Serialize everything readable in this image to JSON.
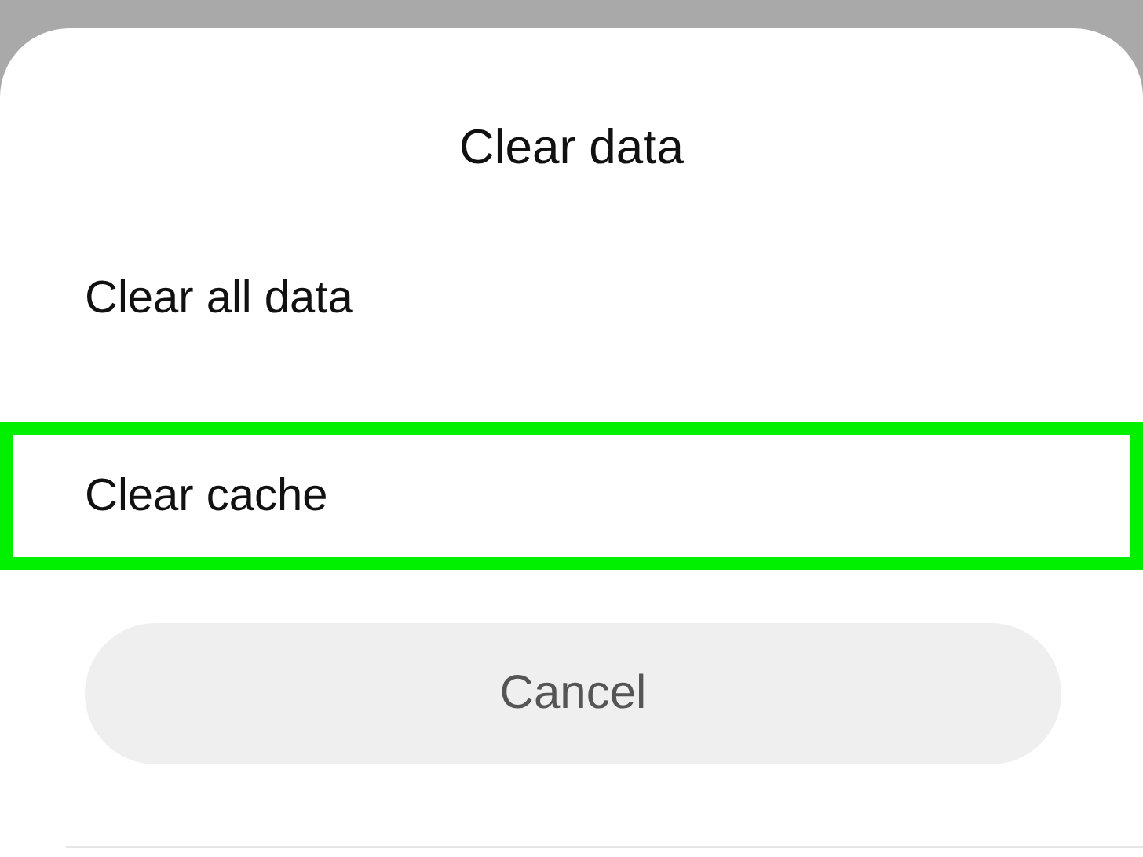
{
  "dialog": {
    "title": "Clear data",
    "options": [
      {
        "label": "Clear all data",
        "highlighted": false
      },
      {
        "label": "Clear cache",
        "highlighted": true
      }
    ],
    "cancel_button": "Cancel"
  }
}
